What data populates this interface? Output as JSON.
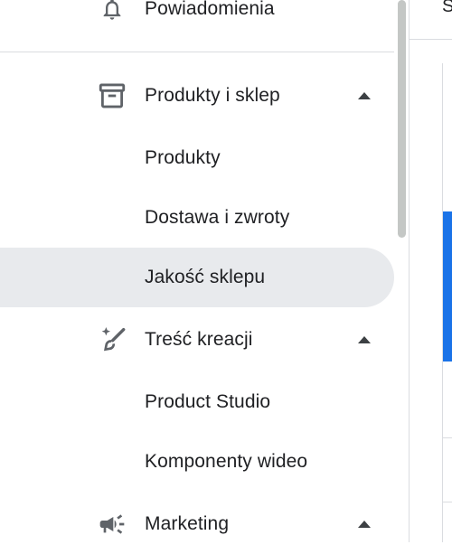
{
  "nav": {
    "notifications": "Powiadomienia",
    "products_store": "Produkty i sklep",
    "products": "Produkty",
    "shipping_returns": "Dostawa i zwroty",
    "store_quality": "Jakość sklepu",
    "creative_content": "Treść kreacji",
    "product_studio": "Product Studio",
    "video_assets": "Komponenty wideo",
    "marketing": "Marketing"
  },
  "right_panel": {
    "cut_letter": "S"
  },
  "colors": {
    "selected_bg": "#e8eaed",
    "accent_blue": "#1a73e8",
    "icon_gray": "#5f6368"
  },
  "icons": {
    "notifications": "bell-icon",
    "products_store": "archive-box-icon",
    "creative_content": "magic-brush-icon",
    "marketing": "megaphone-icon",
    "expand": "chevron-up-icon"
  }
}
